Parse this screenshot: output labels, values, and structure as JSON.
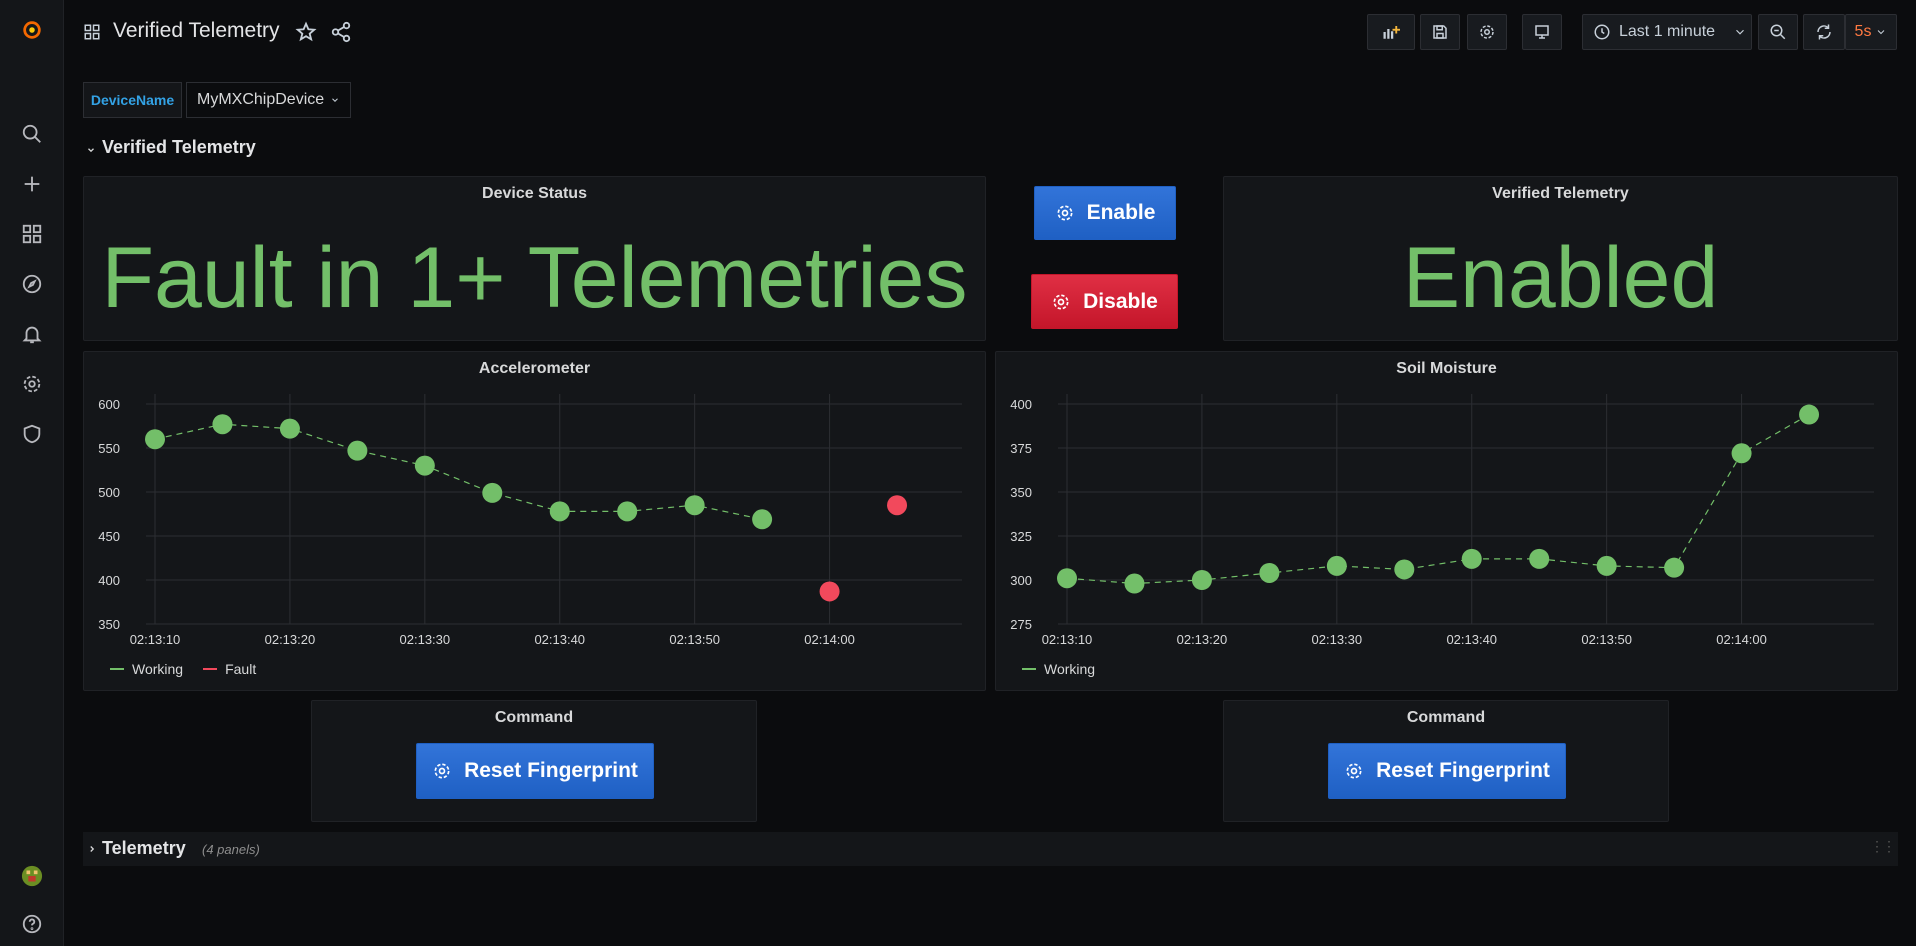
{
  "header": {
    "title": "Verified Telemetry",
    "time_range": "Last 1 minute",
    "refresh_interval": "5s"
  },
  "variables": {
    "label": "DeviceName",
    "value": "MyMXChipDevice"
  },
  "rows": [
    {
      "title": "Verified Telemetry"
    },
    {
      "title": "Telemetry",
      "count": "(4 panels)"
    }
  ],
  "panels": {
    "device_status": {
      "title": "Device Status",
      "value": "Fault in 1+ Telemetries"
    },
    "verified_telemetry": {
      "title": "Verified Telemetry",
      "value": "Enabled"
    },
    "buttons": {
      "enable": "Enable",
      "disable": "Disable"
    },
    "command_left": {
      "title": "Command",
      "button": "Reset Fingerprint"
    },
    "command_right": {
      "title": "Command",
      "button": "Reset Fingerprint"
    }
  },
  "colors": {
    "working": "#73bf69",
    "fault": "#f2495c",
    "blue": "#3274d9",
    "red": "#e02f44"
  },
  "chart_data": [
    {
      "type": "line",
      "title": "Accelerometer",
      "x_ticks": [
        "02:13:10",
        "02:13:20",
        "02:13:30",
        "02:13:40",
        "02:13:50",
        "02:14:00"
      ],
      "y_ticks": [
        350,
        400,
        450,
        500,
        550,
        600
      ],
      "ylim": [
        350,
        600
      ],
      "x_range_seconds": [
        0,
        60
      ],
      "series": [
        {
          "name": "Working",
          "color": "#73bf69",
          "x": [
            0,
            5,
            10,
            15,
            20,
            25,
            30,
            35,
            40,
            45
          ],
          "y": [
            560,
            577,
            572,
            547,
            530,
            499,
            478,
            478,
            485,
            469
          ]
        },
        {
          "name": "Fault",
          "color": "#f2495c",
          "x": [
            50,
            55
          ],
          "y": [
            387,
            485
          ]
        }
      ]
    },
    {
      "type": "line",
      "title": "Soil Moisture",
      "x_ticks": [
        "02:13:10",
        "02:13:20",
        "02:13:30",
        "02:13:40",
        "02:13:50",
        "02:14:00"
      ],
      "y_ticks": [
        275,
        300,
        325,
        350,
        375,
        400
      ],
      "ylim": [
        275,
        400
      ],
      "x_range_seconds": [
        0,
        60
      ],
      "series": [
        {
          "name": "Working",
          "color": "#73bf69",
          "x": [
            0,
            5,
            10,
            15,
            20,
            25,
            30,
            35,
            40,
            45,
            50,
            55
          ],
          "y": [
            301,
            298,
            300,
            304,
            308,
            306,
            312,
            312,
            308,
            307,
            372,
            394
          ]
        }
      ]
    }
  ]
}
